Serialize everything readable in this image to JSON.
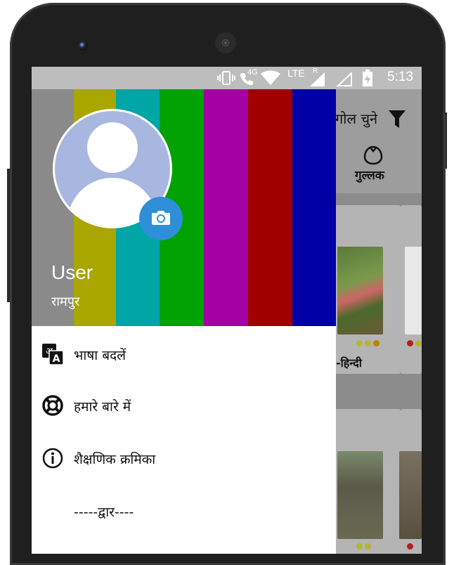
{
  "status_bar": {
    "time": "5:13",
    "network_label": "4G",
    "lte_label": "LTE",
    "roaming_label": "R"
  },
  "background_app": {
    "toolbar_title": "गोल चुने",
    "tab_label": "गुल्लक",
    "card_caption": "-हिन्दी",
    "icons": [
      "filter-icon",
      "gullak-icon"
    ]
  },
  "drawer": {
    "user_name": "User",
    "user_location": "रामपुर",
    "camera_button_icon": "camera-icon",
    "header_colors": [
      "#8a8a8a",
      "#a9a600",
      "#00a5a5",
      "#01a201",
      "#a400a4",
      "#a00000",
      "#0000a4"
    ],
    "menu": [
      {
        "label": "भाषा बदलें",
        "icon": "translate-icon"
      },
      {
        "label": "हमारे बारे में",
        "icon": "lifebuoy-icon"
      },
      {
        "label": "शैक्षणिक क्रमिका",
        "icon": "info-icon"
      },
      {
        "label": "-----द्वार----",
        "icon": ""
      }
    ]
  }
}
